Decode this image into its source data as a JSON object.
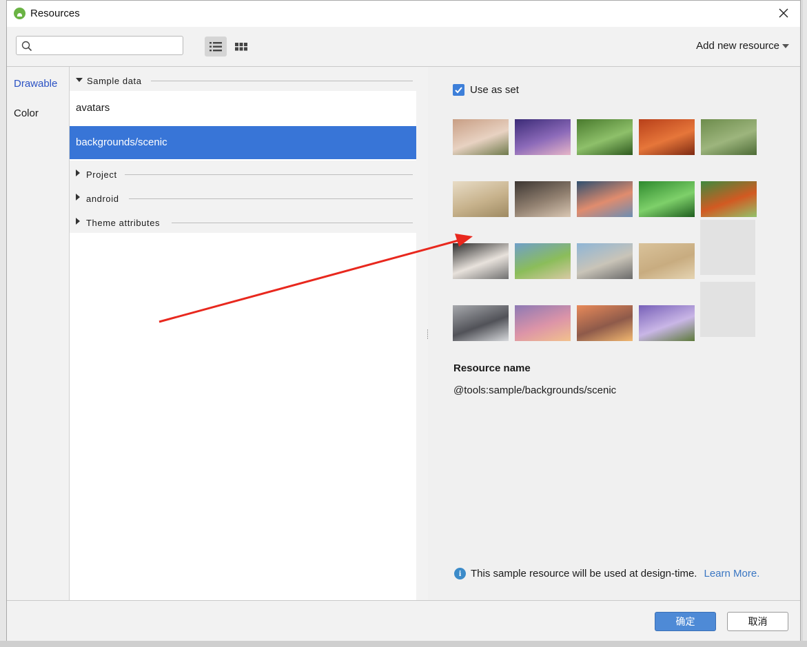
{
  "window": {
    "title": "Resources"
  },
  "toolbar": {
    "search_placeholder": "",
    "add_resource_label": "Add new resource"
  },
  "sidebar": {
    "items": [
      {
        "label": "Drawable",
        "active": true
      },
      {
        "label": "Color",
        "active": false
      }
    ]
  },
  "resource_list": {
    "groups": [
      {
        "label": "Sample data",
        "expanded": true
      },
      {
        "label": "Project",
        "expanded": false
      },
      {
        "label": "android",
        "expanded": false
      },
      {
        "label": "Theme attributes",
        "expanded": false
      }
    ],
    "items": [
      {
        "label": "avatars",
        "selected": false
      },
      {
        "label": "backgrounds/scenic",
        "selected": true
      }
    ]
  },
  "detail": {
    "use_as_set_label": "Use as set",
    "use_as_set_checked": true,
    "resource_name_label": "Resource name",
    "resource_name_value": "@tools:sample/backgrounds/scenic",
    "info_text": "This sample resource will be used at design-time.",
    "learn_more_label": "Learn More."
  },
  "thumbnails": [
    {
      "name": "thumb-blurred-wood",
      "colors": [
        "#c89e84",
        "#e8d2c2",
        "#6f7a4c"
      ]
    },
    {
      "name": "thumb-hiker-silhouette",
      "colors": [
        "#3b2b77",
        "#8c6ab9",
        "#e7b6c8"
      ]
    },
    {
      "name": "thumb-green-flower",
      "colors": [
        "#497a2d",
        "#8ec06a",
        "#2f5a1f"
      ]
    },
    {
      "name": "thumb-autumn-leaves",
      "colors": [
        "#b8401a",
        "#e6763a",
        "#7d2a12"
      ]
    },
    {
      "name": "thumb-field-figure",
      "colors": [
        "#6d8c4c",
        "#9db57d",
        "#4d6b36"
      ]
    },
    {
      "name": "thumb-hazy-hills",
      "colors": [
        "#e8dcc6",
        "#c7b28c",
        "#9e8a62"
      ]
    },
    {
      "name": "thumb-rocky-coast",
      "colors": [
        "#3c3632",
        "#918070",
        "#d9c7b3"
      ]
    },
    {
      "name": "thumb-sunset-lake",
      "colors": [
        "#2f4f6f",
        "#e08c6e",
        "#6b8db3"
      ]
    },
    {
      "name": "thumb-green-grass",
      "colors": [
        "#2e8a2e",
        "#7ed06a",
        "#1f5e1f"
      ]
    },
    {
      "name": "thumb-red-leaf",
      "colors": [
        "#3e8a3e",
        "#d25a22",
        "#92c26a"
      ]
    },
    {
      "name": "thumb-jellyfish",
      "colors": [
        "#2c2c2c",
        "#e8e2dc",
        "#707070"
      ]
    },
    {
      "name": "thumb-green-coast",
      "colors": [
        "#6f9fc9",
        "#8bbd5a",
        "#d8c9a4"
      ]
    },
    {
      "name": "thumb-city-view",
      "colors": [
        "#8eb5d6",
        "#c9c4b8",
        "#6a6a6a"
      ]
    },
    {
      "name": "thumb-sand-texture",
      "colors": [
        "#d9c29a",
        "#c8ac80",
        "#e5d4b2"
      ]
    },
    {
      "name": "thumb-empty-1",
      "colors": []
    },
    {
      "name": "thumb-motorcycle",
      "colors": [
        "#a7a9ad",
        "#515258",
        "#d7d9dc"
      ]
    },
    {
      "name": "thumb-pink-clouds",
      "colors": [
        "#8d79b4",
        "#dc94a8",
        "#f2c18d"
      ]
    },
    {
      "name": "thumb-desert-sunset",
      "colors": [
        "#e88a5a",
        "#8e5a4a",
        "#f2b870"
      ]
    },
    {
      "name": "thumb-purple-flowers",
      "colors": [
        "#7760b8",
        "#c9b6e6",
        "#5d7a3a"
      ]
    },
    {
      "name": "thumb-empty-2",
      "colors": []
    }
  ],
  "footer": {
    "ok_label": "确定",
    "cancel_label": "取消"
  },
  "annotation": {
    "arrow_color": "#e8281e"
  }
}
